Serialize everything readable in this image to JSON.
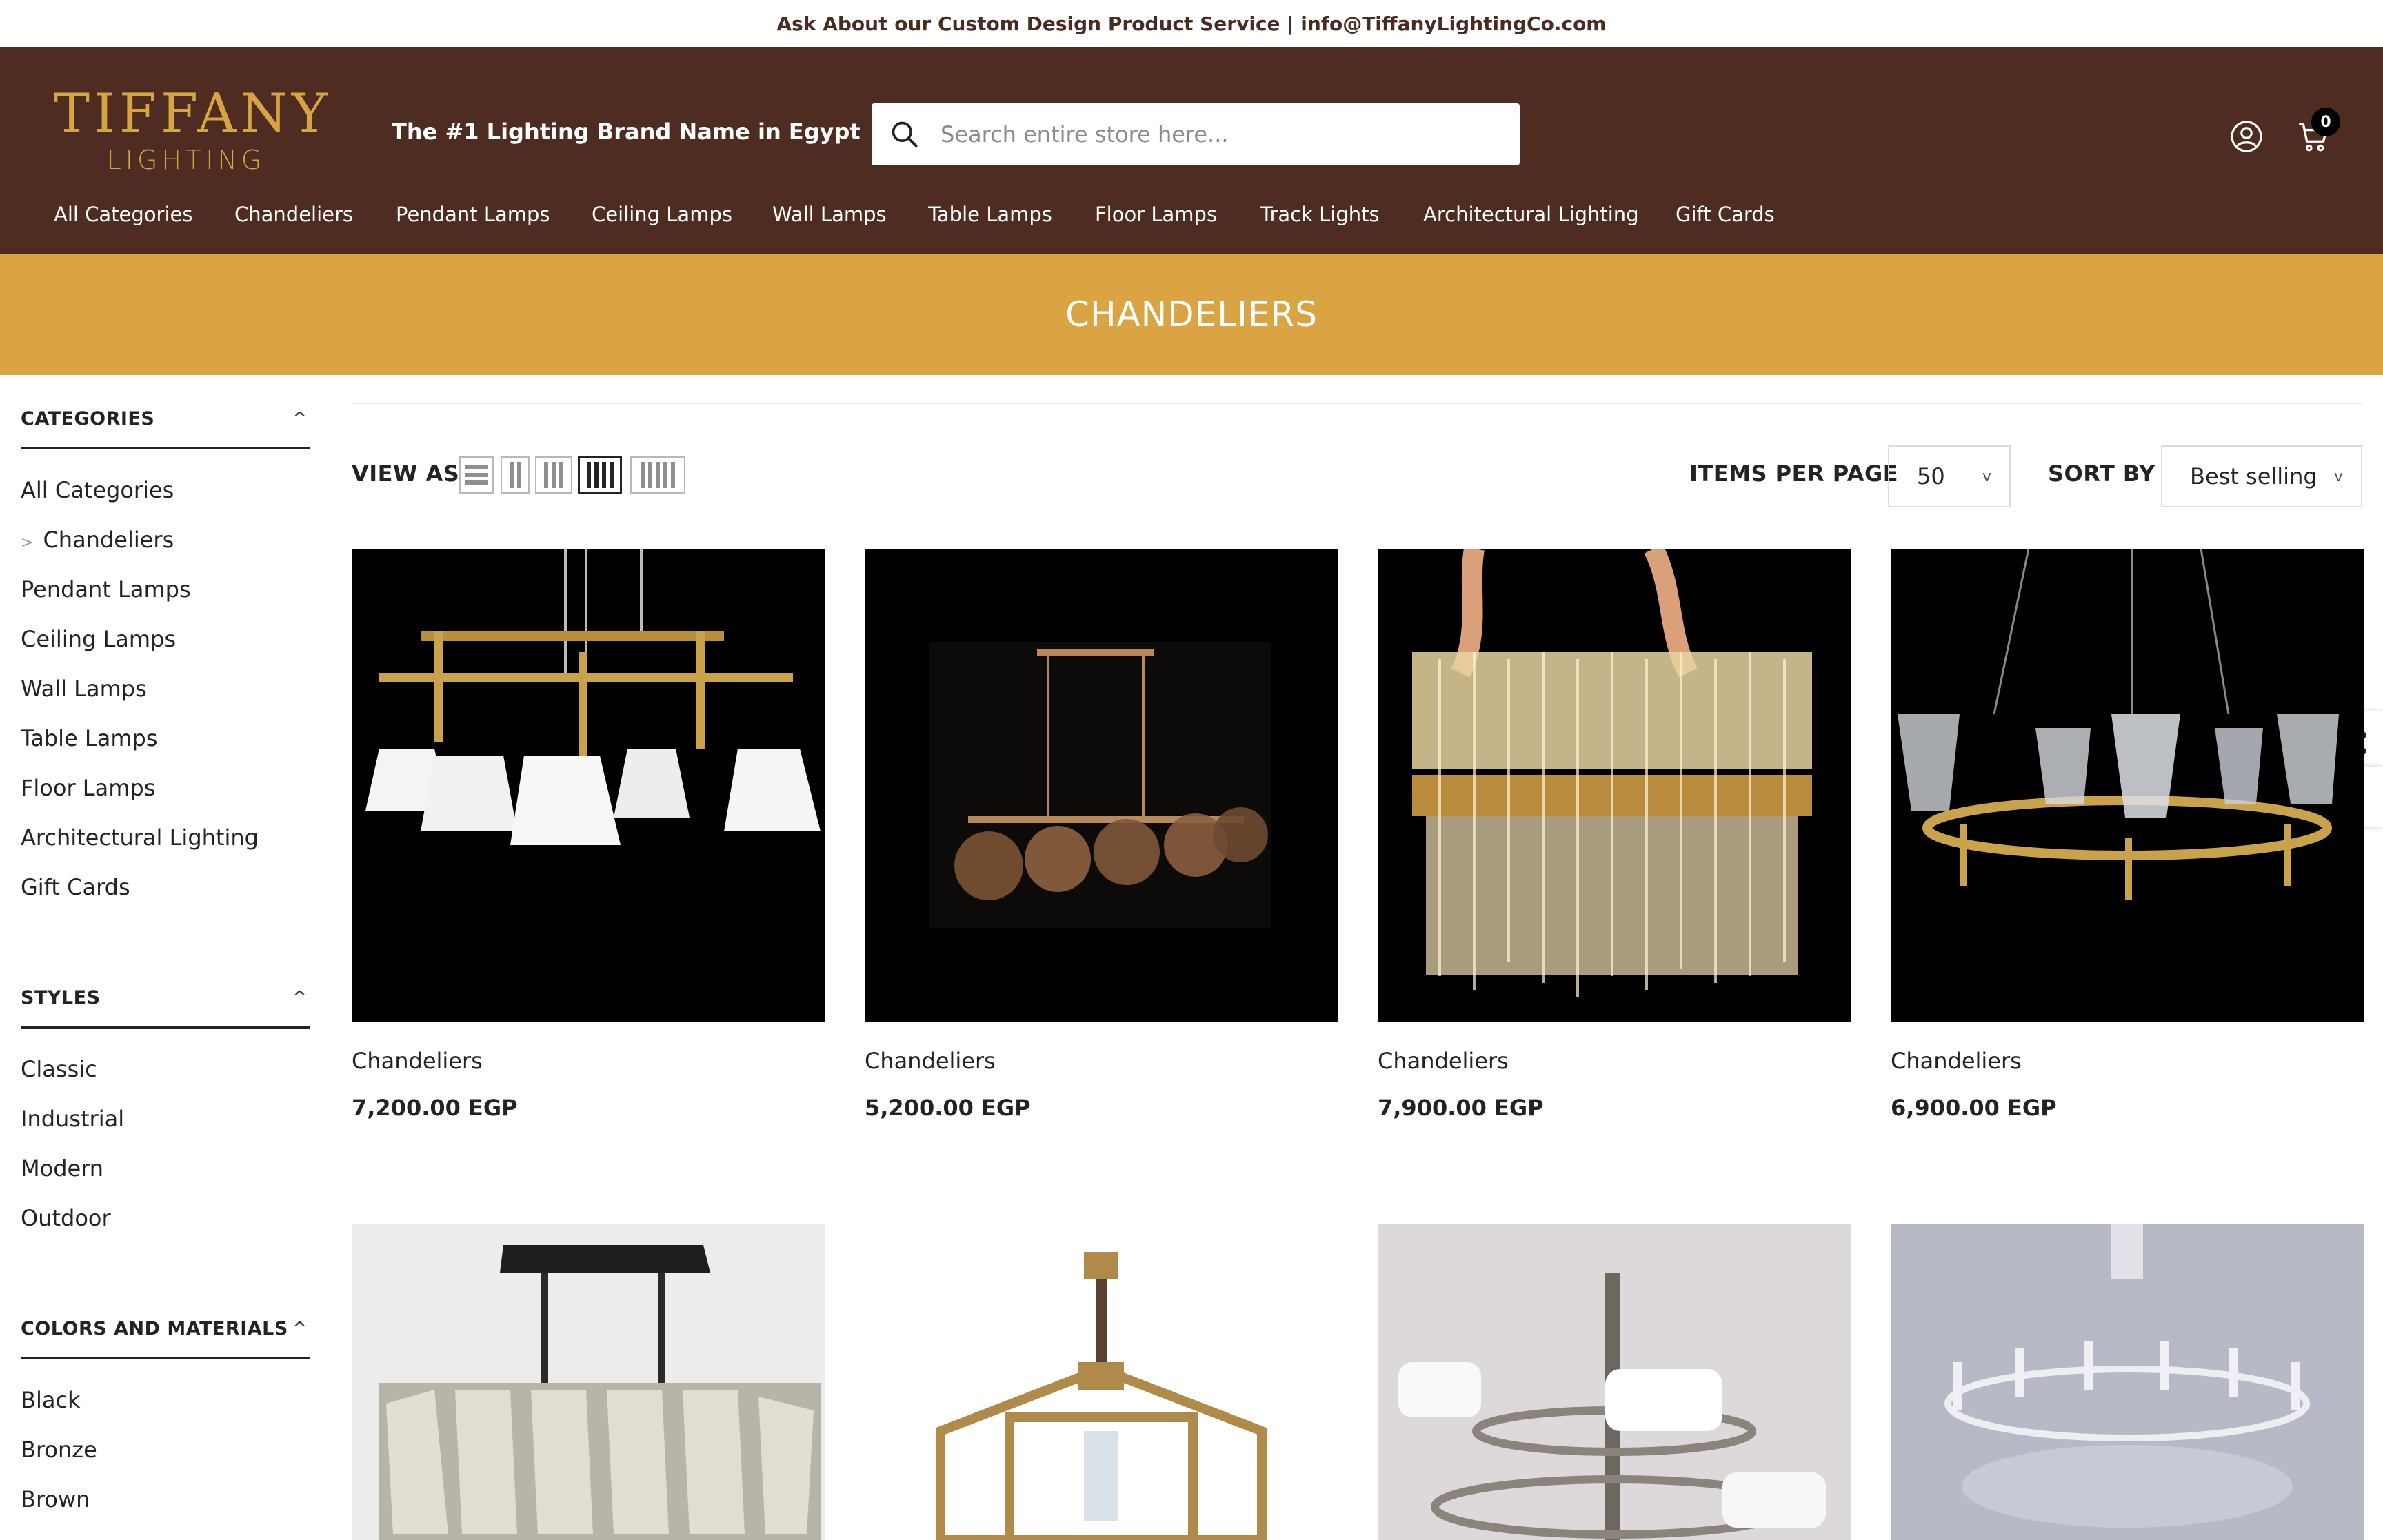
{
  "announcement": "Ask About our Custom Design Product Service | info@TiffanyLightingCo.com",
  "logo": {
    "main": "TIFFANY",
    "sub": "LIGHTING"
  },
  "tagline": "The #1 Lighting Brand Name in Egypt",
  "search": {
    "placeholder": "Search entire store here..."
  },
  "cart": {
    "count": "0"
  },
  "nav": [
    "All Categories",
    "Chandeliers",
    "Pendant Lamps",
    "Ceiling Lamps",
    "Wall Lamps",
    "Table Lamps",
    "Floor Lamps",
    "Track Lights",
    "Architectural Lighting",
    "Gift Cards"
  ],
  "banner_title": "CHANDELIERS",
  "sidebar": {
    "categories": {
      "title": "CATEGORIES",
      "items": [
        "All Categories",
        "Chandeliers",
        "Pendant Lamps",
        "Ceiling Lamps",
        "Wall Lamps",
        "Table Lamps",
        "Floor Lamps",
        "Architectural Lighting",
        "Gift Cards"
      ]
    },
    "styles": {
      "title": "STYLES",
      "items": [
        "Classic",
        "Industrial",
        "Modern",
        "Outdoor"
      ]
    },
    "colors": {
      "title": "COLORS AND MATERIALS",
      "items": [
        "Black",
        "Bronze",
        "Brown"
      ]
    }
  },
  "toolbar": {
    "view_as": "VIEW AS",
    "items_per_page_label": "ITEMS PER PAGE",
    "items_per_page_value": "50",
    "sort_by_label": "SORT BY",
    "sort_by_value": "Best selling"
  },
  "products": [
    {
      "title": "Chandeliers",
      "price": "7,200.00 EGP"
    },
    {
      "title": "Chandeliers",
      "price": "5,200.00 EGP"
    },
    {
      "title": "Chandeliers",
      "price": "7,900.00 EGP"
    },
    {
      "title": "Chandeliers",
      "price": "6,900.00 EGP"
    }
  ],
  "colors": {
    "header_bg": "#4e2c22",
    "banner_bg": "#d9a441",
    "logo_gold": "#d6a443"
  }
}
